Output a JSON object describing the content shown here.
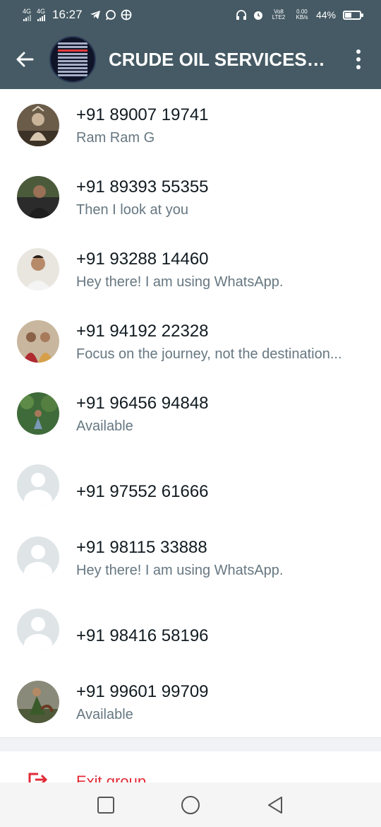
{
  "status_bar": {
    "net1": "4G",
    "net2": "4G",
    "time": "16:27",
    "volte": "Vo8 LTE2",
    "speed": "0.00 KB/s",
    "battery": "44%",
    "battery_level": 0.44
  },
  "header": {
    "title": "CRUDE OIL SERVICES LTD.",
    "back_icon": "arrow-left-icon",
    "menu_icon": "more-vert-icon"
  },
  "participants": [
    {
      "phone": "+91 89007 19741",
      "about": "Ram Ram G",
      "avatar": "photo"
    },
    {
      "phone": "+91 89393 55355",
      "about": "Then I look at you",
      "avatar": "photo"
    },
    {
      "phone": "+91 93288 14460",
      "about": "Hey there! I am using WhatsApp.",
      "avatar": "photo"
    },
    {
      "phone": "+91 94192 22328",
      "about": "Focus on the journey, not the destination...",
      "avatar": "photo"
    },
    {
      "phone": "+91 96456 94848",
      "about": "Available",
      "avatar": "photo"
    },
    {
      "phone": "+91 97552 61666",
      "about": "",
      "avatar": "default"
    },
    {
      "phone": "+91 98115 33888",
      "about": "Hey there! I am using WhatsApp.",
      "avatar": "default"
    },
    {
      "phone": "+91 98416 58196",
      "about": "",
      "avatar": "default"
    },
    {
      "phone": "+91 99601 99709",
      "about": "Available",
      "avatar": "photo"
    }
  ],
  "exit": {
    "label": "Exit group",
    "icon": "exit-icon",
    "color": "#e02b37"
  },
  "colors": {
    "appbar": "#455a64",
    "accent": "#e02b37"
  },
  "nav": {
    "recent_icon": "square-icon",
    "home_icon": "circle-icon",
    "back_icon": "triangle-back-icon"
  }
}
